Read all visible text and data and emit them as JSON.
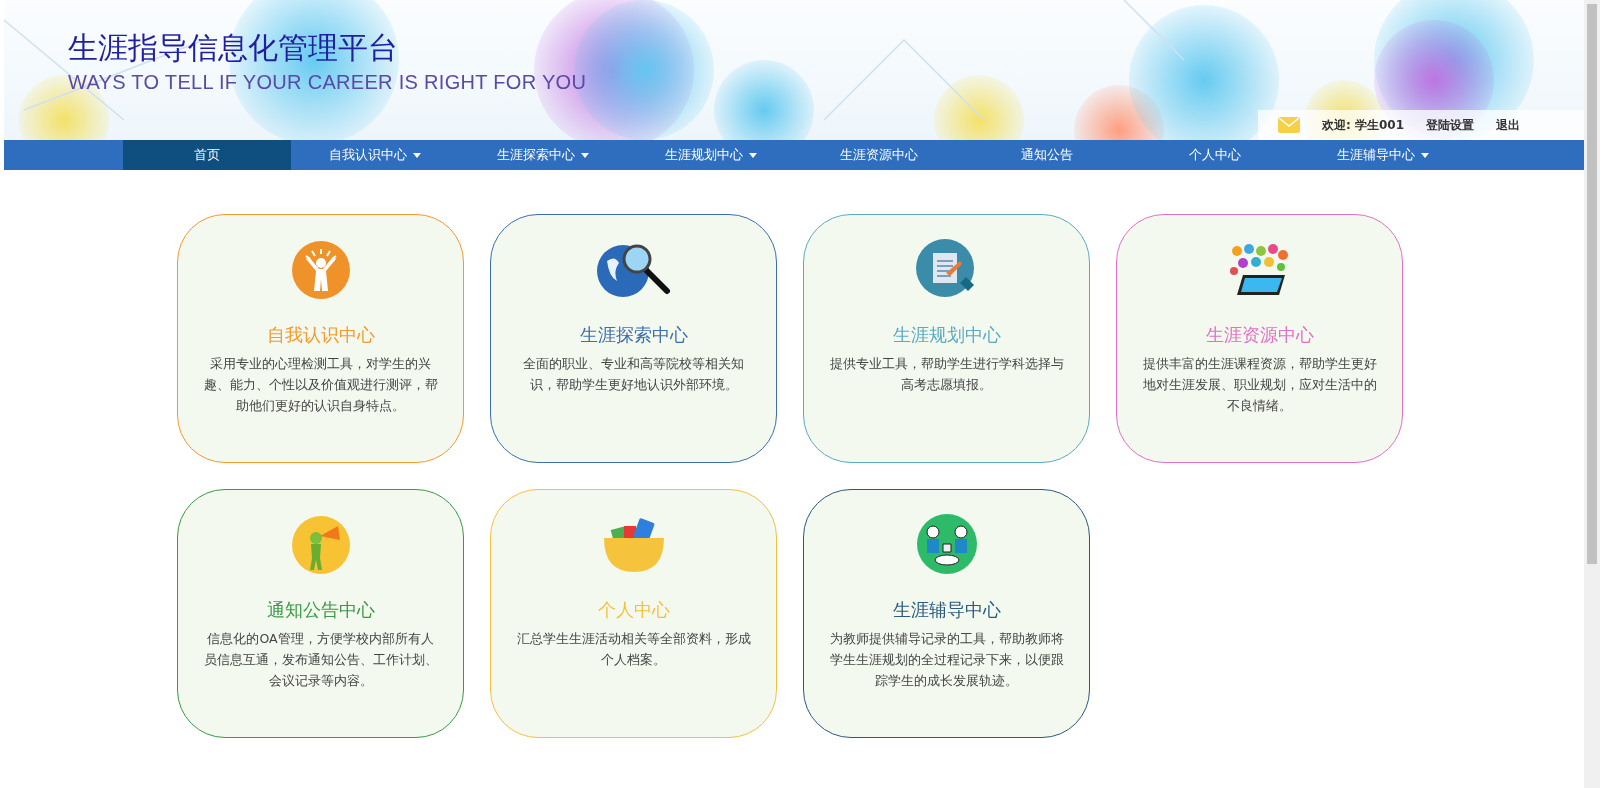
{
  "header": {
    "title": "生涯指导信息化管理平台",
    "subtitle": "WAYS TO TELL IF YOUR CAREER IS RIGHT FOR YOU",
    "user_links": [
      "欢迎: 学生001",
      "登陆设置",
      "退出"
    ]
  },
  "nav": [
    {
      "label": "首页",
      "selected": true,
      "dropdown": false
    },
    {
      "label": "自我认识中心",
      "selected": false,
      "dropdown": true
    },
    {
      "label": "生涯探索中心",
      "selected": false,
      "dropdown": true
    },
    {
      "label": "生涯规划中心",
      "selected": false,
      "dropdown": true
    },
    {
      "label": "生涯资源中心",
      "selected": false,
      "dropdown": false
    },
    {
      "label": "通知公告",
      "selected": false,
      "dropdown": false
    },
    {
      "label": "个人中心",
      "selected": false,
      "dropdown": false
    },
    {
      "label": "生涯辅导中心",
      "selected": false,
      "dropdown": true
    }
  ],
  "cards": [
    {
      "kind": "person",
      "title": "自我认识中心",
      "color": "#f39a2b",
      "text": "采用专业的心理检测工具，对学生的兴趣、能力、个性以及价值观进行测评，帮助他们更好的认识自身特点。"
    },
    {
      "kind": "globe",
      "title": "生涯探索中心",
      "color": "#3a6fb0",
      "text": "全面的职业、专业和高等院校等相关知识，帮助学生更好地认识外部环境。"
    },
    {
      "kind": "document",
      "title": "生涯规划中心",
      "color": "#5aaac4",
      "text": "提供专业工具，帮助学生进行学科选择与高考志愿填报。"
    },
    {
      "kind": "tablet",
      "title": "生涯资源中心",
      "color": "#e070c8",
      "text": "提供丰富的生涯课程资源，帮助学生更好地对生涯发展、职业规划，应对生活中的不良情绪。"
    },
    {
      "kind": "megaphone",
      "title": "通知公告中心",
      "color": "#3a9a48",
      "text": "信息化的OA管理，方便学校内部所有人员信息互通，发布通知公告、工作计划、会议记录等内容。"
    },
    {
      "kind": "bowl",
      "title": "个人中心",
      "color": "#f5c040",
      "text": "汇总学生生涯活动相关等全部资料，形成个人档案。"
    },
    {
      "kind": "meeting",
      "title": "生涯辅导中心",
      "color": "#2c5a7e",
      "text": "为教师提供辅导记录的工具，帮助教师将学生生涯规划的全过程记录下来，以便跟踪学生的成长发展轨迹。"
    }
  ]
}
